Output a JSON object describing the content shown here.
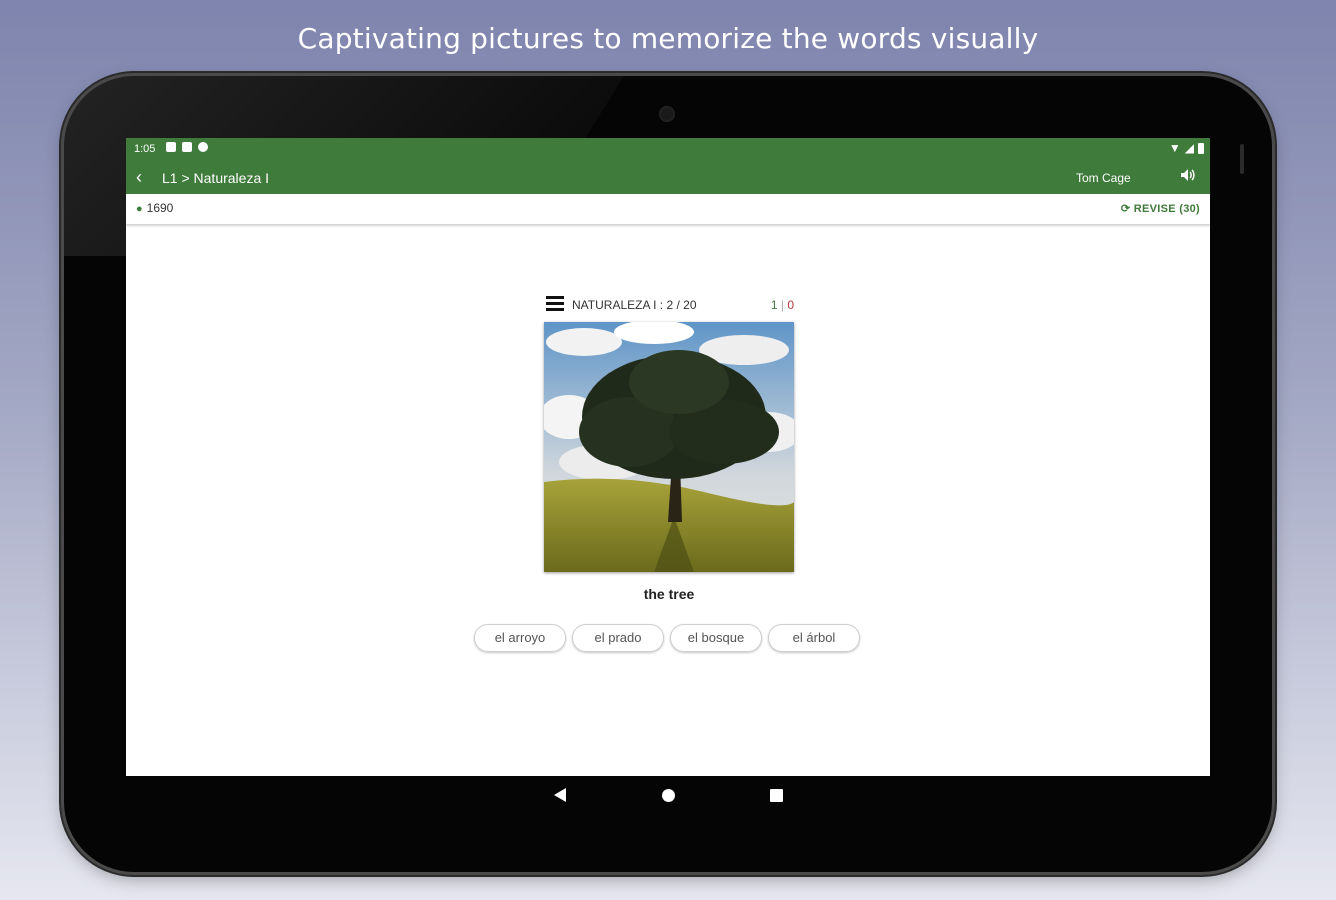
{
  "headline": "Captivating pictures to memorize the words visually",
  "status": {
    "time": "1:05"
  },
  "toolbar": {
    "breadcrumb": "L1 > Naturaleza I",
    "username": "Tom Cage"
  },
  "infobar": {
    "points": "1690",
    "revise_label": "REVISE (30)"
  },
  "lesson": {
    "title": "NATURALEZA I : 2 / 20",
    "correct": "1",
    "separator": "|",
    "wrong": "0"
  },
  "card": {
    "caption": "the tree"
  },
  "choices": [
    "el arroyo",
    "el prado",
    "el bosque",
    "el árbol"
  ],
  "colors": {
    "accent": "#3f7b3a",
    "wrong": "#b23a3a"
  },
  "icons": [
    "back-icon",
    "volume-icon",
    "pin-icon",
    "refresh-icon",
    "menu-icon",
    "nav-back-icon",
    "nav-home-icon",
    "nav-recent-icon"
  ]
}
